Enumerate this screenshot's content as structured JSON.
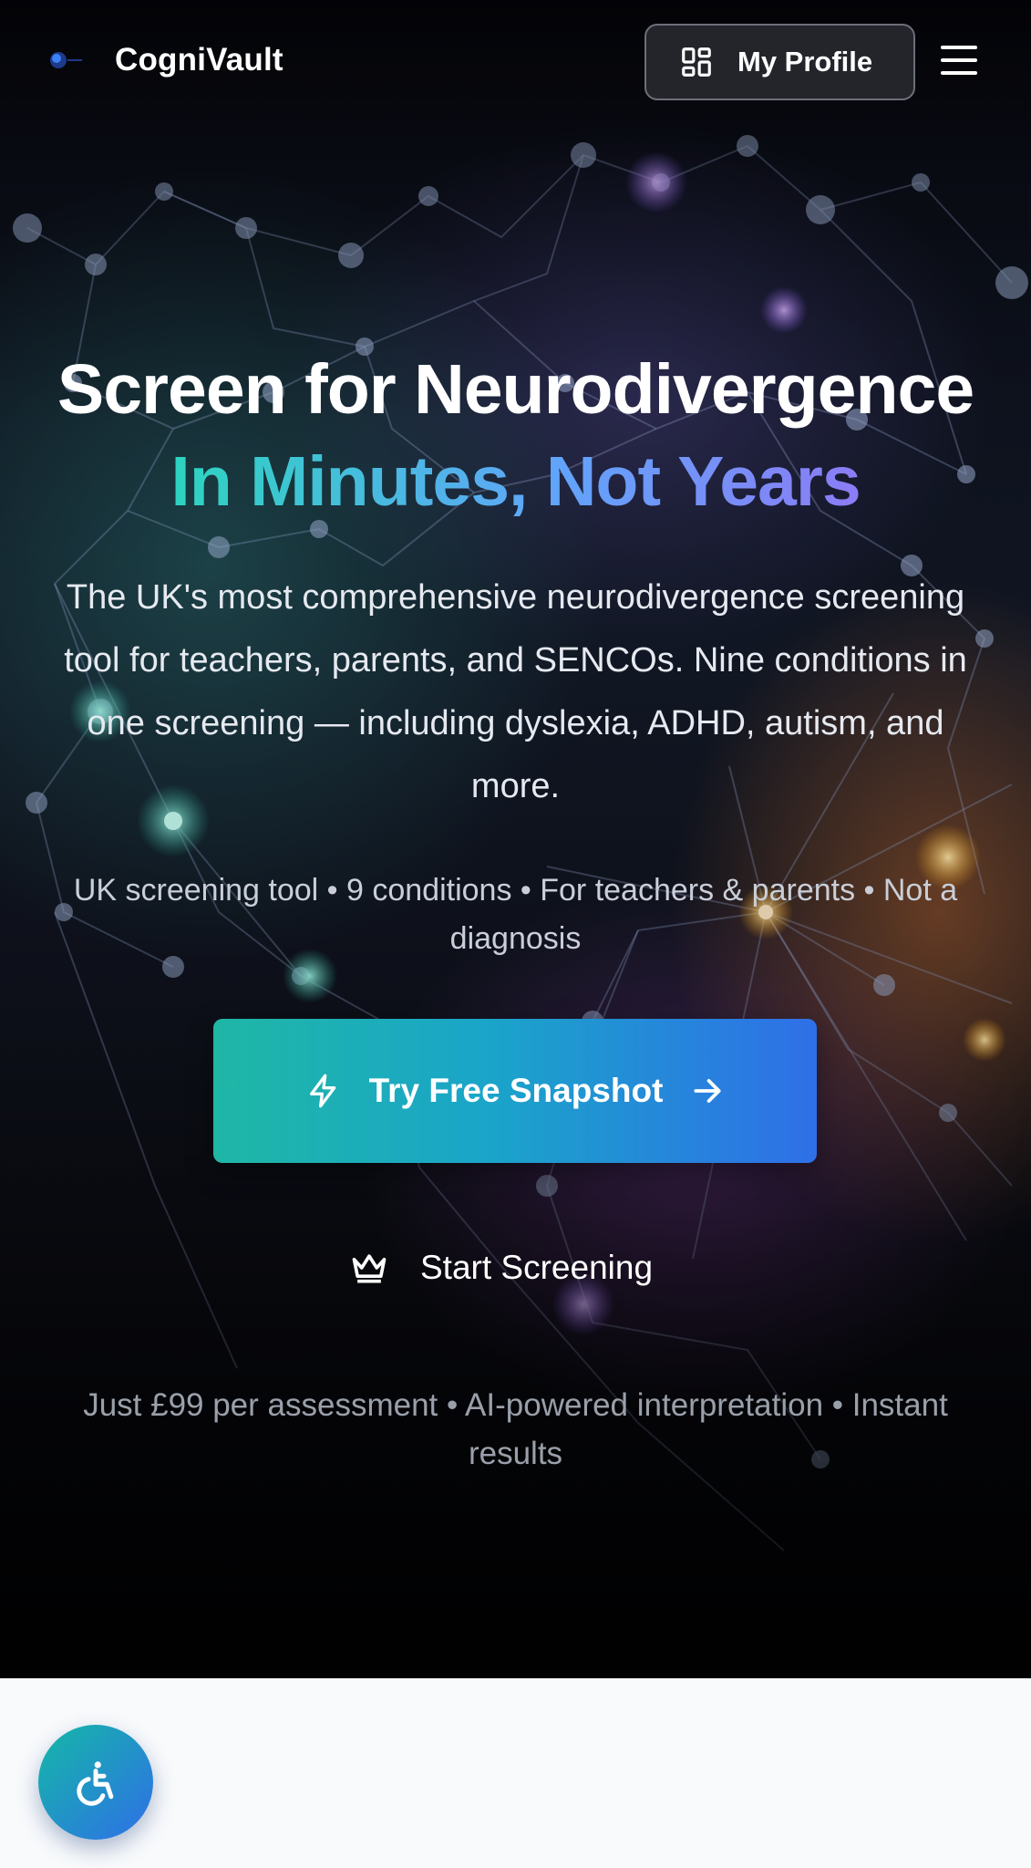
{
  "header": {
    "brand": "CogniVault",
    "logo_icon": "brain-logo",
    "profile_button": {
      "label": "My Profile",
      "icon": "dashboard-grid-icon"
    },
    "menu_icon": "hamburger-menu-icon"
  },
  "hero": {
    "headline": "Screen for Neurodivergence",
    "subheadline": "In Minutes, Not Years",
    "description": "The UK's most comprehensive neurodivergence screening tool for teachers, parents, and SENCOs. Nine conditions in one screening — including dyslexia, ADHD, autism, and more.",
    "tagline": "UK screening tool • 9 conditions • For teachers & parents • Not a diagnosis",
    "cta_primary": {
      "label": "Try Free Snapshot",
      "icon": "lightning-icon",
      "trailing_icon": "arrow-right-icon"
    },
    "cta_secondary": {
      "label": "Start Screening",
      "icon": "crown-icon"
    },
    "pricing": "Just £99 per assessment • AI-powered interpretation • Instant results"
  },
  "accessibility": {
    "icon": "accessibility-icon"
  },
  "colors": {
    "accent_teal": "#2dd4bf",
    "accent_blue": "#2f6fe8",
    "accent_violet": "#8b7cf6",
    "hero_background": "#0b0e18",
    "page_background": "#f8fafc"
  }
}
